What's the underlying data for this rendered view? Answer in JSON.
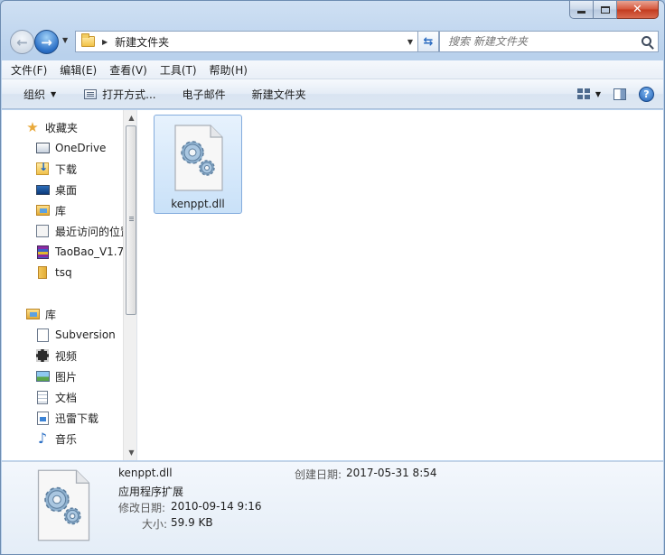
{
  "window": {
    "minimize": "",
    "maximize": "",
    "close": "✕"
  },
  "address": {
    "crumb": "新建文件夹"
  },
  "search": {
    "placeholder": "搜索 新建文件夹"
  },
  "menu": [
    "文件(F)",
    "编辑(E)",
    "查看(V)",
    "工具(T)",
    "帮助(H)"
  ],
  "toolbar": {
    "organize": "组织",
    "open_with": "打开方式...",
    "email": "电子邮件",
    "new_folder": "新建文件夹"
  },
  "nav": {
    "favorites": "收藏夹",
    "favorites_items": [
      "OneDrive",
      "下载",
      "桌面",
      "库",
      "最近访问的位置",
      "TaoBao_V1.7",
      "tsq"
    ],
    "libraries": "库",
    "libraries_items": [
      "Subversion",
      "视频",
      "图片",
      "文档",
      "迅雷下载",
      "音乐"
    ]
  },
  "files": [
    {
      "name": "kenppt.dll"
    }
  ],
  "details": {
    "name": "kenppt.dll",
    "type": "应用程序扩展",
    "modified_label": "修改日期:",
    "modified_value": "2010-09-14 9:16",
    "size_label": "大小:",
    "size_value": "59.9 KB",
    "created_label": "创建日期:",
    "created_value": "2017-05-31 8:54"
  }
}
